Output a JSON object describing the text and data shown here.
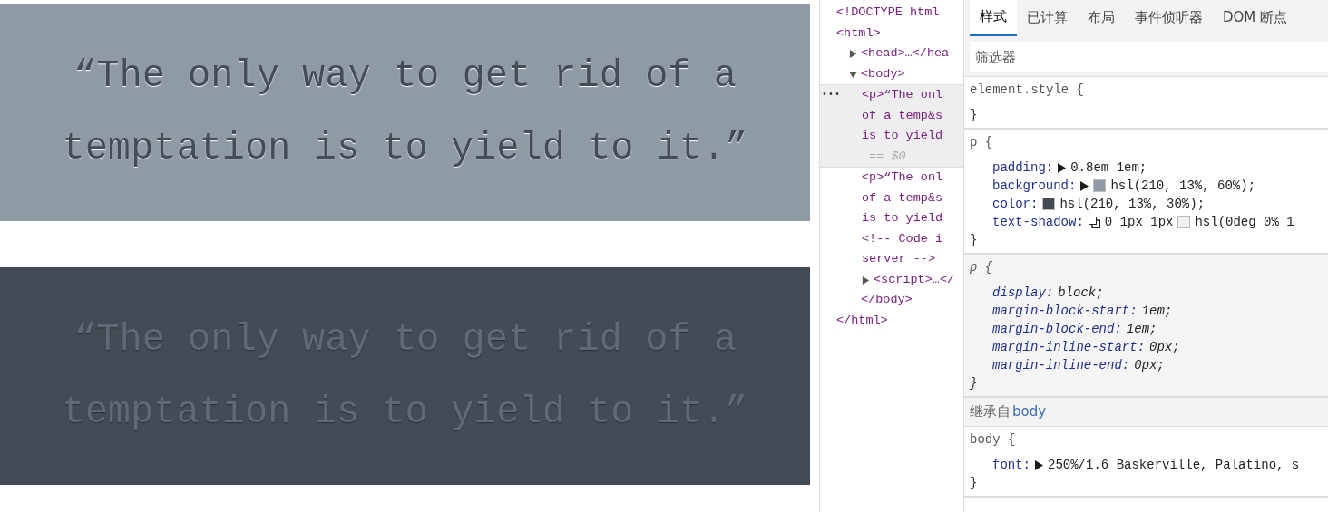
{
  "quotes": [
    {
      "text": "“The only way to get rid of a temptation is to yield to it.”",
      "kind": "light"
    },
    {
      "text": "“The only way to get rid of a temptation is to yield to it.”",
      "kind": "dark"
    }
  ],
  "elements": {
    "nodes": [
      {
        "lines": [
          "<!DOCTYPE html"
        ],
        "selected": false
      },
      {
        "lines": [
          "<html>"
        ],
        "selected": false,
        "close": "</html>",
        "children": [
          {
            "lines": [
              "<head>…</hea"
            ],
            "expanded": false,
            "selected": false
          },
          {
            "lines": [
              "<body>"
            ],
            "expanded": true,
            "selected": false,
            "close": "</body>",
            "children": [
              {
                "lines": [
                  "<p>“The onl",
                  "of a temp&s",
                  "is to yield"
                ],
                "selected": true,
                "menu": "•••",
                "marker": "== $0"
              },
              {
                "lines": [
                  "<p>“The onl",
                  "of a temp&s",
                  "is to yield",
                  "<!-- Code i",
                  "server -->"
                ],
                "selected": false
              },
              {
                "lines": [
                  "<script>…</"
                ],
                "expanded": false,
                "selected": false
              }
            ]
          }
        ]
      }
    ]
  },
  "styles": {
    "tabs": [
      {
        "label": "样式",
        "selected": true
      },
      {
        "label": "已计算",
        "selected": false
      },
      {
        "label": "布局",
        "selected": false
      },
      {
        "label": "事件侦听器",
        "selected": false
      },
      {
        "label": "DOM 断点",
        "selected": false
      }
    ],
    "filter": {
      "placeholder": "筛选器"
    },
    "sections": [
      {
        "kind": "rule",
        "selector": "element.style {",
        "close": "}",
        "user_agent": false
      },
      {
        "kind": "rule",
        "selector": "p {",
        "close": "}",
        "user_agent": false,
        "declarations": [
          {
            "property": "padding:",
            "parts": [
              {
                "kind": "expander",
                "expanded": false
              },
              {
                "kind": "text",
                "text": "0.8em 1em;"
              }
            ]
          },
          {
            "property": "background:",
            "parts": [
              {
                "kind": "expander",
                "expanded": false
              },
              {
                "kind": "swatch",
                "color": "#8f9aa6"
              },
              {
                "kind": "text",
                "text": "hsl(210, 13%, 60%);"
              }
            ]
          },
          {
            "property": "color:",
            "parts": [
              {
                "kind": "swatch",
                "color": "#434b54"
              },
              {
                "kind": "text",
                "text": "hsl(210, 13%, 30%);"
              }
            ]
          },
          {
            "property": "text-shadow:",
            "parts": [
              {
                "kind": "shadow-editor"
              },
              {
                "kind": "text",
                "text": "0 1px 1px"
              },
              {
                "kind": "swatch",
                "color": "#f2f2f2"
              },
              {
                "kind": "text",
                "text": "hsl(0deg 0% 1"
              }
            ]
          }
        ]
      },
      {
        "kind": "rule",
        "selector": "p {",
        "close": "}",
        "user_agent": true,
        "declarations": [
          {
            "property": "display:",
            "parts": [
              {
                "kind": "text",
                "text": "block;"
              }
            ]
          },
          {
            "property": "margin-block-start:",
            "parts": [
              {
                "kind": "text",
                "text": "1em;"
              }
            ]
          },
          {
            "property": "margin-block-end:",
            "parts": [
              {
                "kind": "text",
                "text": "1em;"
              }
            ]
          },
          {
            "property": "margin-inline-start:",
            "parts": [
              {
                "kind": "text",
                "text": "0px;"
              }
            ]
          },
          {
            "property": "margin-inline-end:",
            "parts": [
              {
                "kind": "text",
                "text": "0px;"
              }
            ]
          }
        ]
      },
      {
        "kind": "inherited",
        "label": "继承自",
        "link": "body"
      },
      {
        "kind": "rule",
        "selector": "body {",
        "close": "}",
        "user_agent": false,
        "declarations": [
          {
            "property": "font:",
            "parts": [
              {
                "kind": "expander",
                "expanded": false
              },
              {
                "kind": "text",
                "text": "250%/1.6 Baskerville, Palatino, s"
              }
            ]
          }
        ]
      }
    ]
  }
}
